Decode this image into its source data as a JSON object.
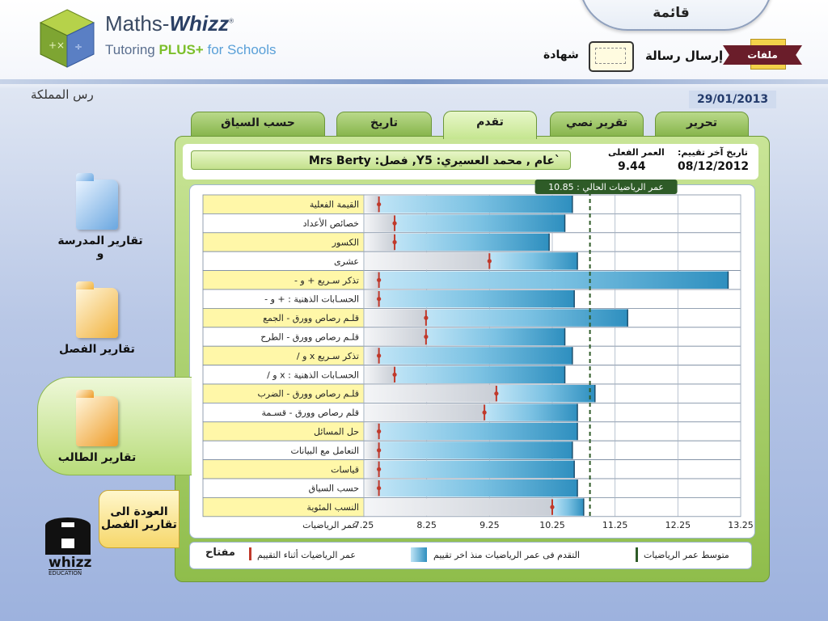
{
  "header": {
    "brand_main": "Maths-",
    "brand_bold": "Whizz",
    "brand_reg": "®",
    "brand_sub_a": "Tutoring ",
    "brand_sub_b": "PLUS+",
    "brand_sub_c": " for Schools",
    "menu_label": "قائمة",
    "files_label": "ملفات",
    "send_message_label": "إرسال رسالة",
    "certificate_label": "شهادة",
    "school_name": "رس المملكة",
    "date": "29/01/2013"
  },
  "tabs": [
    {
      "label": "حسب السياق",
      "active": false
    },
    {
      "label": "تاريخ",
      "active": false
    },
    {
      "label": "تقدم",
      "active": true
    },
    {
      "label": "تقرير نصي",
      "active": false
    },
    {
      "label": "تحرير",
      "active": false
    }
  ],
  "student_info": {
    "summary": "Mrs Berty :فصل ,Y5 :عام , محمد العسيري`",
    "actual_age_label": "العمر الفعلى",
    "actual_age": "9.44",
    "last_assessment_label": ":تاريخ آخر تقييم",
    "last_assessment_date": "08/12/2012"
  },
  "sidebar": {
    "school_reports": "تقارير المدرسة",
    "school_reports_extra": "و",
    "class_reports": "تقارير الفصل",
    "student_reports": "تقارير الطالب",
    "back_line1": "العودة الى",
    "back_line2": "تقارير الفصل",
    "logo_word": "whizz",
    "logo_sub": "EDUCATION"
  },
  "legend": {
    "key_label": "مفتاح",
    "during_assessment": "عمر الرياضيات أثناء التقييم",
    "progress_since": "التقدم فى عمر الرياضيات منذ اخر تقييم",
    "average": "متوسط عمر الرياضيات"
  },
  "colors": {
    "accent_green": "#8fbd4b",
    "bar_blue": "#3d9cc9",
    "marker_red": "#c0392b",
    "row_yellow": "#fff7a8",
    "average_line": "#2e5b27"
  },
  "chart_data": {
    "type": "bar",
    "orientation": "horizontal",
    "current_badge_value": "10.85",
    "current_badge_label": "عمر الرياضيات الحالي",
    "current_age": 10.85,
    "xlabel": "عمر الرياضيات",
    "xlim": [
      7.25,
      13.25
    ],
    "xticks": [
      "7.25",
      "8.25",
      "9.25",
      "10.25",
      "11.25",
      "12.25",
      "13.25"
    ],
    "categories": [
      "القيمة الفعلية",
      "خصائص الأعداد",
      "الكسور",
      "عشرى",
      "- تذكر سـريع + و",
      "- الحسـابات الذهنية : + و",
      "قلـم رصاص وورق - الجمع",
      "قلـم رصاص وورق - الطرح",
      "/ و x تذكر سـريع",
      "/ و x : الحسـابات الذهنية",
      "قلـم رصاص وورق - الضرب",
      "قلم رصاص وورق - قسـمة",
      "حل المسائل",
      "التعامل مع البيانات",
      "قياسات",
      "حسب السياق",
      "النسب المئوية"
    ],
    "series": [
      {
        "values": [
          7.49,
          7.74,
          7.74,
          9.25,
          7.49,
          7.49,
          8.24,
          8.24,
          7.49,
          7.74,
          9.36,
          9.17,
          7.49,
          7.49,
          7.49,
          7.49,
          10.25
        ]
      },
      {
        "values": [
          10.57,
          10.45,
          10.2,
          10.65,
          13.05,
          10.6,
          11.45,
          10.45,
          10.57,
          10.45,
          10.93,
          10.65,
          10.65,
          10.57,
          10.6,
          10.65,
          10.75
        ]
      }
    ]
  }
}
